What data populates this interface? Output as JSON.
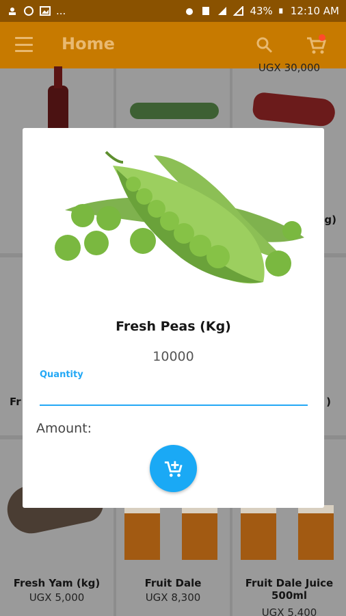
{
  "status_bar": {
    "left_extra": "...",
    "battery": "43%",
    "time": "12:10 AM"
  },
  "app_bar": {
    "title": "Home",
    "icons": [
      "menu-icon",
      "search-icon",
      "cart-icon"
    ]
  },
  "products": [
    {
      "price": "UGX 30,000"
    },
    {
      "name": "Fr"
    },
    {
      "name": "g)"
    },
    {
      "name": ")"
    },
    {
      "name": "Fresh Yam (kg)",
      "price": "UGX 5,000"
    },
    {
      "name": "Fruit Dale",
      "price": "UGX 8,300"
    },
    {
      "name": "Fruit Dale Juice 500ml",
      "price": "UGX 5,400"
    }
  ],
  "dialog": {
    "title": "Fresh Peas (Kg)",
    "price": "10000",
    "quantity_label": "Quantity",
    "quantity_value": "",
    "amount_label": "Amount:",
    "add_icon": "add-shopping-cart-icon"
  },
  "colors": {
    "app_bar": "#c77a00",
    "status_bar": "#8a5200",
    "accent": "#1aa9f5"
  }
}
